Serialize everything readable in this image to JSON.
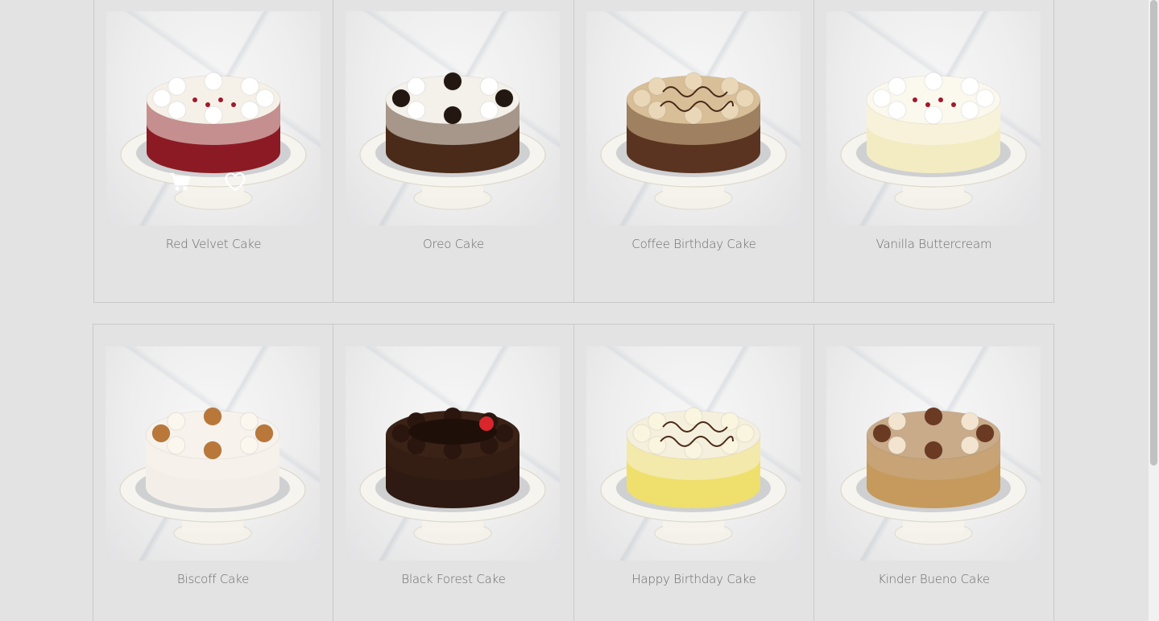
{
  "products": [
    {
      "name": "Red Velvet Cake",
      "cake": "#8c1a24",
      "frost": "#f6f1e8",
      "top": "rose",
      "show_actions": true
    },
    {
      "name": "Oreo Cake",
      "cake": "#4a2a18",
      "frost": "#f4f0ea",
      "top": "oreo",
      "show_actions": false
    },
    {
      "name": "Coffee Birthday Cake",
      "cake": "#5a3420",
      "frost": "#d8bf98",
      "top": "text",
      "show_actions": false
    },
    {
      "name": "Vanilla Buttercream",
      "cake": "#f3ecc2",
      "frost": "#fbf8ee",
      "top": "rose",
      "show_actions": false
    },
    {
      "name": "Biscoff Cake",
      "cake": "#f3efe8",
      "frost": "#f7f3ec",
      "top": "biscoff",
      "show_actions": false
    },
    {
      "name": "Black Forest Cake",
      "cake": "#2e1a12",
      "frost": "#3b2216",
      "top": "choc",
      "show_actions": false
    },
    {
      "name": "Happy Birthday Cake",
      "cake": "#efdf6d",
      "frost": "#f5f0dd",
      "top": "text",
      "show_actions": false
    },
    {
      "name": "Kinder Bueno Cake",
      "cake": "#c59a5c",
      "frost": "#c9ab8a",
      "top": "bueno",
      "show_actions": false
    }
  ],
  "icons": {
    "cart": "cart-icon",
    "heart": "heart-icon"
  }
}
